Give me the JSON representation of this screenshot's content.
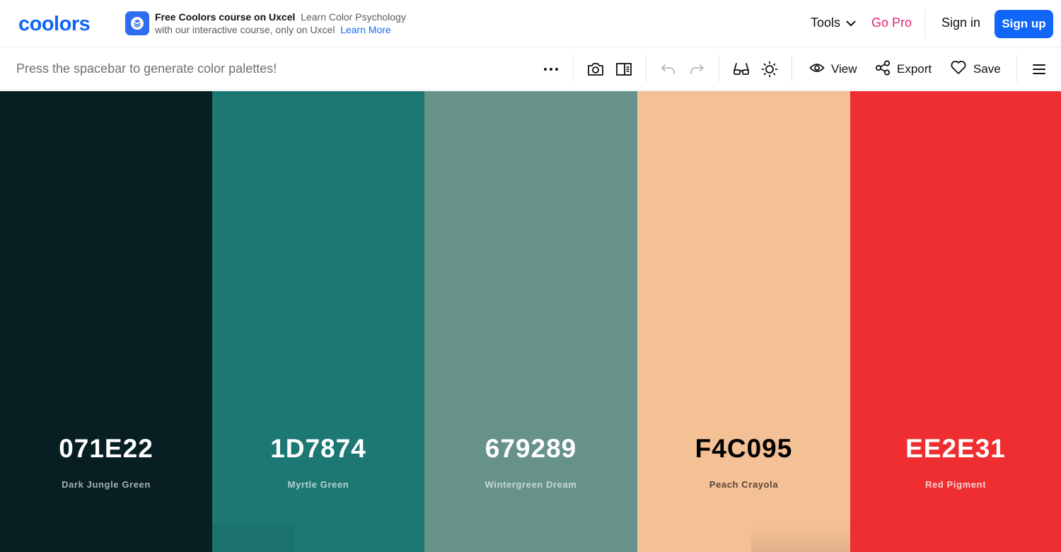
{
  "header": {
    "logo_text": "coolors",
    "promo": {
      "title": "Free Coolors course on Uxcel",
      "text": "Learn Color Psychology with our interactive course, only on Uxcel",
      "link": "Learn More"
    },
    "nav": {
      "tools": "Tools",
      "go_pro": "Go Pro",
      "sign_in": "Sign in",
      "sign_up": "Sign up"
    },
    "colors": {
      "brand": "#1066f6",
      "go_pro": "#e6247a"
    }
  },
  "toolbar": {
    "hint": "Press the spacebar to generate color palettes!",
    "view": "View",
    "export": "Export",
    "save": "Save",
    "icons": [
      "more-options-icon",
      "camera-icon",
      "side-panel-icon",
      "undo-icon",
      "redo-icon",
      "glasses-icon",
      "sun-icon",
      "eye-icon",
      "share-icon",
      "heart-icon",
      "hamburger-menu-icon"
    ]
  },
  "palette": [
    {
      "hex": "071E22",
      "name": "Dark Jungle Green",
      "color": "#071e22",
      "text_color": "#ffffff",
      "name_color": "#a7b1b3"
    },
    {
      "hex": "1D7874",
      "name": "Myrtle Green",
      "color": "#1d7874",
      "text_color": "#ffffff",
      "name_color": "#b7d4d2"
    },
    {
      "hex": "679289",
      "name": "Wintergreen Dream",
      "color": "#679289",
      "text_color": "#ffffff",
      "name_color": "#c8d8d4"
    },
    {
      "hex": "F4C095",
      "name": "Peach Crayola",
      "color": "#f4c095",
      "text_color": "#000000",
      "name_color": "#5a4637"
    },
    {
      "hex": "EE2E31",
      "name": "Red Pigment",
      "color": "#ee2e31",
      "text_color": "#ffffff",
      "name_color": "#fbd0d0"
    }
  ]
}
